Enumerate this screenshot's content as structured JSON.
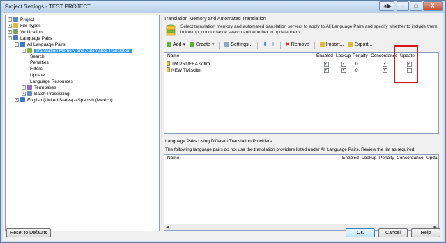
{
  "window": {
    "title": "Project Settings - TEST PROJECT"
  },
  "titlebar_buttons": [
    "◄▶",
    "–",
    "□",
    "X"
  ],
  "tree": [
    {
      "label": "Project",
      "expander": "+",
      "icon": "project-icon",
      "color": "#5b87c5",
      "indent": 0
    },
    {
      "label": "File Types",
      "expander": "+",
      "icon": "file-types-icon",
      "color": "#e0b83c",
      "indent": 0
    },
    {
      "label": "Verification",
      "expander": "+",
      "icon": "verification-icon",
      "color": "#7aa35a",
      "indent": 0
    },
    {
      "label": "Language Pairs",
      "expander": "-",
      "icon": "language-pairs-icon",
      "color": "#4a79c2",
      "indent": 0
    },
    {
      "label": "All Language Pairs",
      "expander": "-",
      "icon": "arrow-icon",
      "color": "#3a78d8",
      "indent": 1
    },
    {
      "label": "Translation Memory and Automated Translation",
      "expander": "-",
      "icon": "database-icon",
      "color": "#7fb53c",
      "indent": 2,
      "selected": true
    },
    {
      "label": "Search",
      "expander": "",
      "icon": "",
      "indent": 3
    },
    {
      "label": "Penalties",
      "expander": "",
      "icon": "",
      "indent": 3
    },
    {
      "label": "Filters",
      "expander": "",
      "icon": "",
      "indent": 3
    },
    {
      "label": "Update",
      "expander": "",
      "icon": "",
      "indent": 3
    },
    {
      "label": "Language Resources",
      "expander": "",
      "icon": "",
      "indent": 3
    },
    {
      "label": "Termbases",
      "expander": "+",
      "icon": "termbase-icon",
      "color": "#8a6bc0",
      "indent": 2
    },
    {
      "label": "Batch Processing",
      "expander": "+",
      "icon": "batch-icon",
      "color": "#5f8fc9",
      "indent": 2
    },
    {
      "label": "English (United States)->Spanish (Mexico)",
      "expander": "+",
      "icon": "arrow-icon",
      "color": "#3a78d8",
      "indent": 1
    }
  ],
  "panel": {
    "title": "Translation Memory and Automated Translation",
    "description": "Select translation memory and automated translation servers to apply to All Language Pairs and specify whether to include them in lookup, concordance search and whether to update them."
  },
  "toolbar": {
    "add": "Add",
    "create": "Create",
    "settings": "Settings...",
    "remove": "Remove",
    "import": "Import...",
    "export": "Export..."
  },
  "tm_grid": {
    "columns": [
      "Name",
      "Enabled",
      "Lookup",
      "Penalty",
      "Concordance",
      "Update"
    ],
    "rows": [
      {
        "name": "TM PRUEBA.sdltm",
        "enabled": true,
        "lookup": true,
        "penalty": "0",
        "concordance": true,
        "update": true
      },
      {
        "name": "NEW TM.sdltm",
        "enabled": true,
        "lookup": true,
        "penalty": "0",
        "concordance": true,
        "update": false
      }
    ]
  },
  "lang_pairs": {
    "title": "Language Pairs Using Different Translation Providers",
    "description": "The following language pairs do not use the translation providers listed under All Language Pairs. Review the list as required.",
    "columns": [
      "Name",
      "Enabled",
      "Lookup",
      "Penalty",
      "Concordance",
      "Upda"
    ]
  },
  "buttons": {
    "reset": "Reset to Defaults",
    "ok": "OK",
    "cancel": "Cancel",
    "help": "Help"
  },
  "accent": {
    "selection": "#3399ff",
    "highlight": "#d9141a"
  },
  "check_mark": "✓"
}
